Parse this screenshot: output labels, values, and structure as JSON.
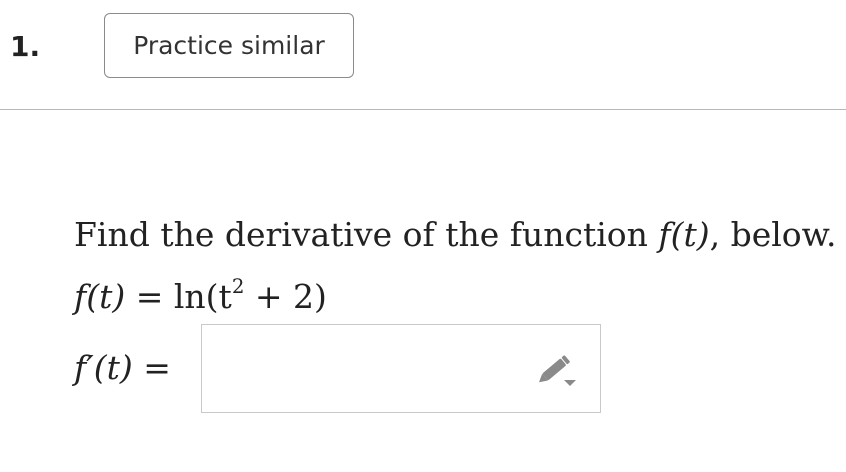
{
  "question": {
    "number": "1.",
    "practice_button_label": "Practice similar"
  },
  "problem": {
    "prompt_prefix": "Find the derivative of the function ",
    "prompt_function": "f(t)",
    "prompt_suffix": ", below.",
    "function_lhs": "f(t) = ",
    "function_rhs_ln": "ln",
    "function_rhs_open": "(t",
    "function_rhs_exp": "2",
    "function_rhs_close": " + 2)",
    "answer_label": "f′(t) ="
  },
  "answer": {
    "value": "",
    "placeholder": ""
  },
  "icons": {
    "editor_toggle": "pencil-dropdown-icon"
  },
  "colors": {
    "text": "#222222",
    "button_border": "#8a8a8a",
    "divider": "#b7b7b7",
    "input_border": "#c9c9c9",
    "icon": "#888888"
  }
}
